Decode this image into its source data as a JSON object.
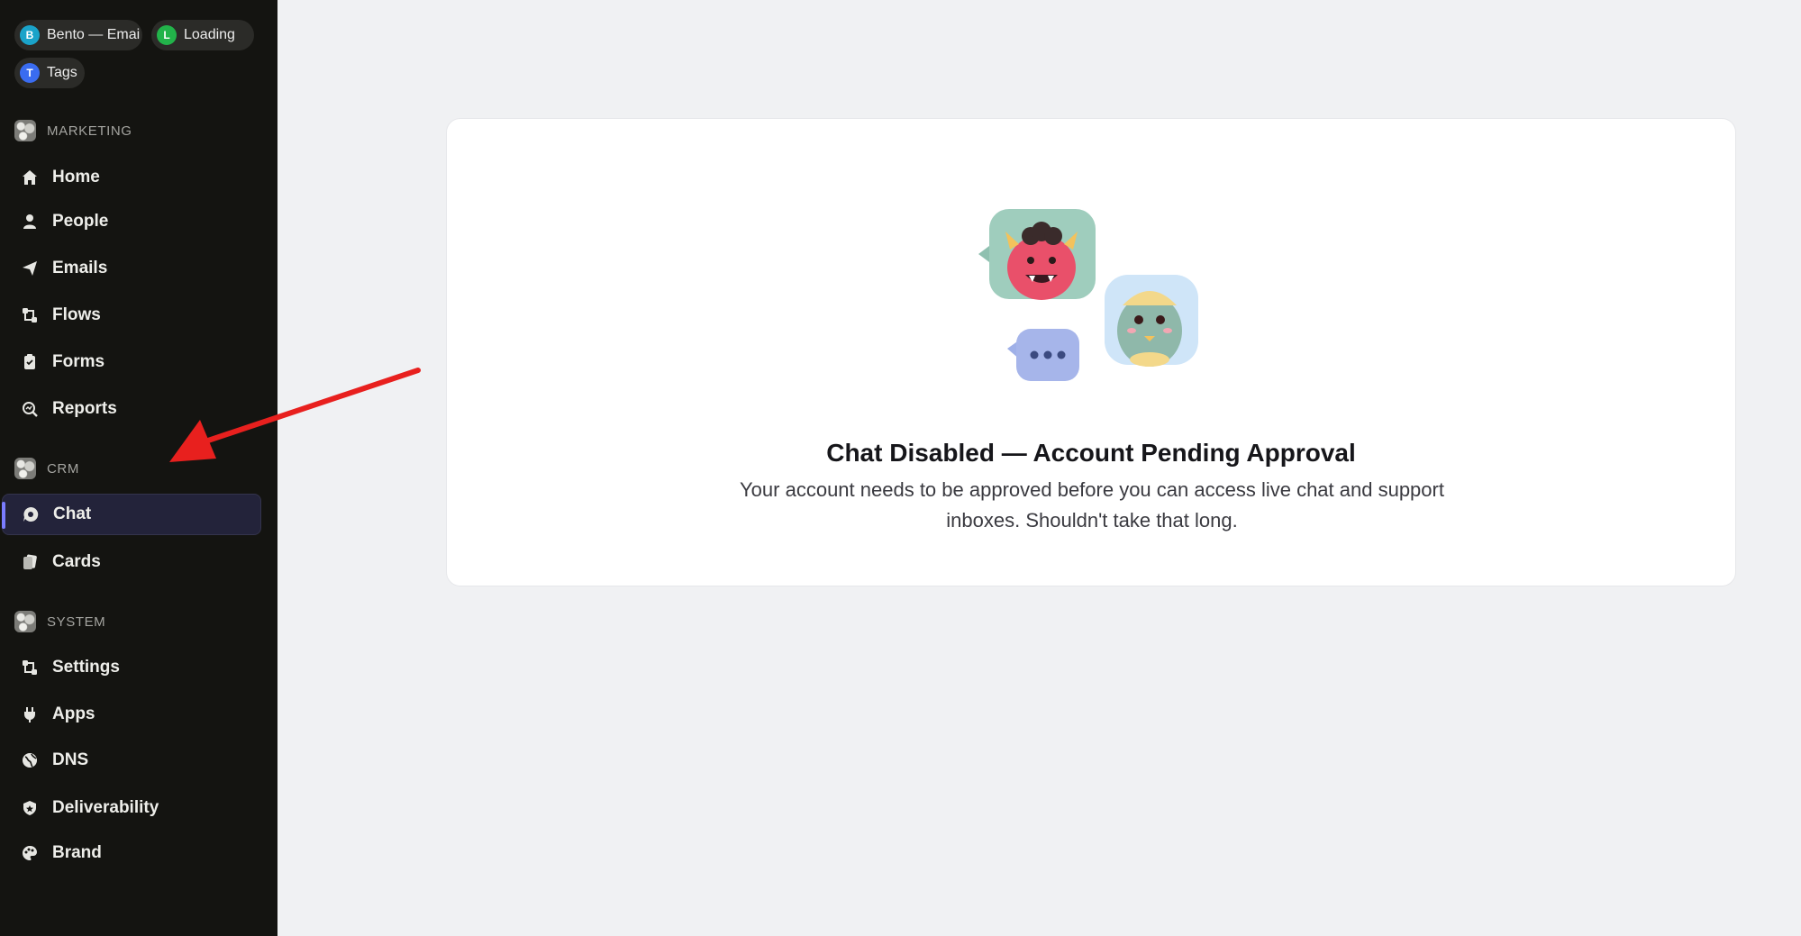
{
  "sidebar": {
    "pills": [
      {
        "initial": "B",
        "label": "Bento — Emai",
        "color": "#1aa3c9"
      },
      {
        "initial": "L",
        "label": "Loading",
        "color": "#22b34a"
      },
      {
        "initial": "T",
        "label": "Tags",
        "color": "#3a6cf0"
      }
    ],
    "sections": [
      {
        "title": "MARKETING",
        "items": [
          {
            "label": "Home",
            "icon": "home-icon"
          },
          {
            "label": "People",
            "icon": "person-icon"
          },
          {
            "label": "Emails",
            "icon": "send-icon"
          },
          {
            "label": "Flows",
            "icon": "flows-icon"
          },
          {
            "label": "Forms",
            "icon": "clipboard-icon"
          },
          {
            "label": "Reports",
            "icon": "magnifier-icon"
          }
        ]
      },
      {
        "title": "CRM",
        "items": [
          {
            "label": "Chat",
            "icon": "chat-bubble-icon",
            "active": true
          },
          {
            "label": "Cards",
            "icon": "cards-icon"
          }
        ]
      },
      {
        "title": "SYSTEM",
        "items": [
          {
            "label": "Settings",
            "icon": "settings-icon"
          },
          {
            "label": "Apps",
            "icon": "plug-icon"
          },
          {
            "label": "DNS",
            "icon": "globe-icon"
          },
          {
            "label": "Deliverability",
            "icon": "shield-icon"
          },
          {
            "label": "Brand",
            "icon": "palette-icon"
          }
        ]
      }
    ]
  },
  "main": {
    "card": {
      "title": "Chat Disabled — Account Pending Approval",
      "description": "Your account needs to be approved before you can access live chat and support inboxes. Shouldn't take that long."
    }
  },
  "colors": {
    "sidebar_bg": "#141411",
    "active_accent": "#7a7cff",
    "arrow": "#e8201e"
  }
}
